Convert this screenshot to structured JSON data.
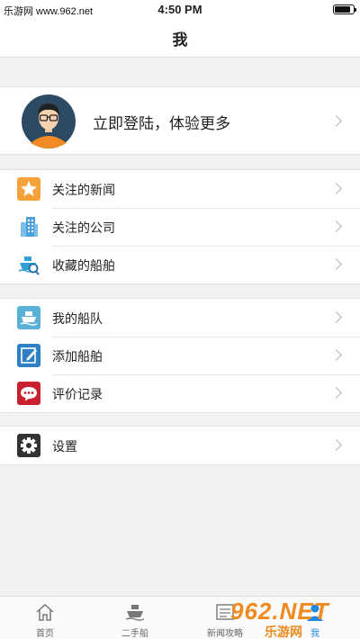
{
  "status_bar": {
    "watermark_text": "乐游网 www.962.net",
    "time": "4:50 PM",
    "battery_level": 0.85
  },
  "nav": {
    "title": "我"
  },
  "profile": {
    "login_text": "立即登陆，体验更多"
  },
  "groups": [
    [
      {
        "label": "关注的新闻",
        "icon": "star-icon",
        "color": "#f5a23a"
      },
      {
        "label": "关注的公司",
        "icon": "building-icon",
        "color": "#4aa3df"
      },
      {
        "label": "收藏的船舶",
        "icon": "ship-search-icon",
        "color": "#2f9fd8"
      }
    ],
    [
      {
        "label": "我的船队",
        "icon": "fleet-icon",
        "color": "#5ab0d6"
      },
      {
        "label": "添加船舶",
        "icon": "edit-icon",
        "color": "#2f7fc4"
      },
      {
        "label": "评价记录",
        "icon": "comment-icon",
        "color": "#c8202f"
      }
    ],
    [
      {
        "label": "设置",
        "icon": "gear-icon",
        "color": "#333333"
      }
    ]
  ],
  "tabs": [
    {
      "label": "首页",
      "icon": "home-icon"
    },
    {
      "label": "二手船",
      "icon": "ship-icon"
    },
    {
      "label": "新闻攻略",
      "icon": "news-icon"
    },
    {
      "label": "我",
      "icon": "profile-icon",
      "active": true
    }
  ],
  "overlay_watermark": {
    "big": "962.NET",
    "small": "乐游网"
  },
  "colors": {
    "accent": "#1e88e5",
    "background": "#f2f2f4"
  }
}
